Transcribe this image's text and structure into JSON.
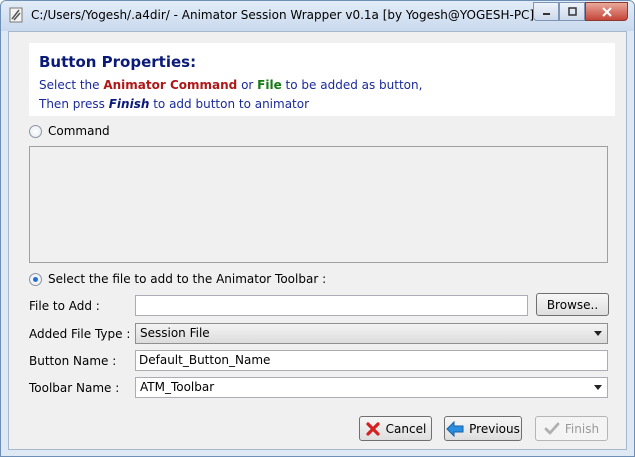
{
  "window": {
    "title": "C:/Users/Yogesh/.a4dir/ - Animator Session Wrapper v0.1a [by Yogesh@YOGESH-PC]"
  },
  "header": {
    "title": "Button Properties:",
    "line1_a": "Select the ",
    "line1_cmd": "Animator Command",
    "line1_b": " or ",
    "line1_file": "File",
    "line1_c": " to be added as button,",
    "line2_a": "Then press ",
    "line2_finish": "Finish",
    "line2_b": " to add button to animator"
  },
  "options": {
    "command_label": "Command",
    "command_selected": false,
    "file_label": "Select the file to add to the Animator Toolbar :",
    "file_selected": true
  },
  "form": {
    "file_to_add_label": "File to Add :",
    "file_to_add_value": "",
    "browse_label": "Browse..",
    "file_type_label": "Added File Type :",
    "file_type_value": "Session File",
    "button_name_label": "Button Name :",
    "button_name_value": "Default_Button_Name",
    "toolbar_name_label": "Toolbar Name :",
    "toolbar_name_value": "ATM_Toolbar"
  },
  "buttons": {
    "cancel": "Cancel",
    "previous": "Previous",
    "finish": "Finish"
  },
  "colors": {
    "header_title": "#0a1a78",
    "command_red": "#b01818",
    "file_green": "#147a14",
    "instruction_blue": "#1a2a9a"
  }
}
